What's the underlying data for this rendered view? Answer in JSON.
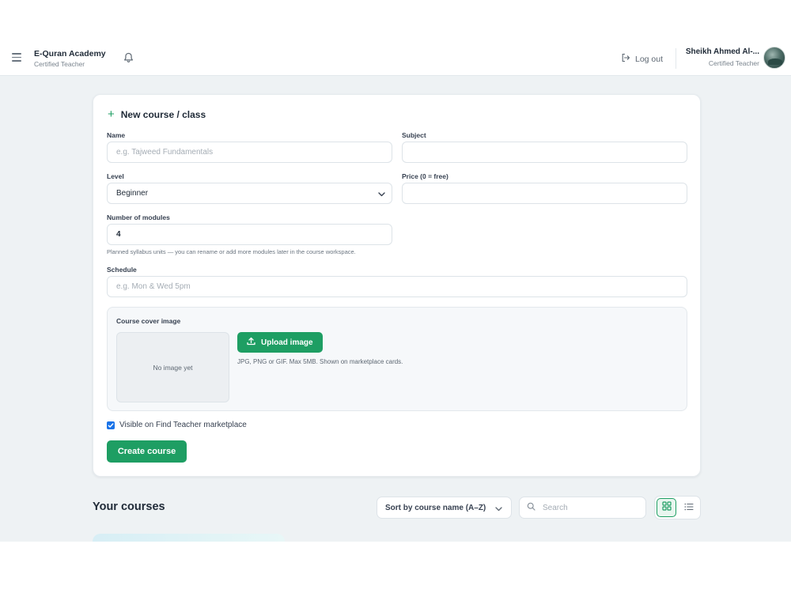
{
  "header": {
    "brand_title": "E-Quran Academy",
    "brand_subtitle": "Certified Teacher",
    "logout_label": "Log out",
    "user_name": "Sheikh Ahmed Al-...",
    "user_role": "Certified Teacher"
  },
  "form": {
    "title": "New course / class",
    "name_label": "Name",
    "name_placeholder": "e.g. Tajweed Fundamentals",
    "subject_label": "Subject",
    "subject_value": "",
    "level_label": "Level",
    "level_value": "Beginner",
    "price_label": "Price (0 = free)",
    "price_value": "",
    "modules_label": "Number of modules",
    "modules_value": "4",
    "modules_hint": "Planned syllabus units — you can rename or add more modules later in the course workspace.",
    "schedule_label": "Schedule",
    "schedule_placeholder": "e.g. Mon & Wed 5pm",
    "cover_label": "Course cover image",
    "no_image_text": "No image yet",
    "upload_label": "Upload image",
    "upload_hint": "JPG, PNG or GIF. Max 5MB. Shown on marketplace cards.",
    "visible_label": "Visible on Find Teacher marketplace",
    "visible_checked": true,
    "create_label": "Create course"
  },
  "courses": {
    "title": "Your courses",
    "sort_value": "Sort by course name (A–Z)",
    "search_placeholder": "Search",
    "view_mode": "grid"
  },
  "colors": {
    "accent": "#1e9e63",
    "background": "#eef2f4",
    "checkbox": "#1a73e8"
  }
}
